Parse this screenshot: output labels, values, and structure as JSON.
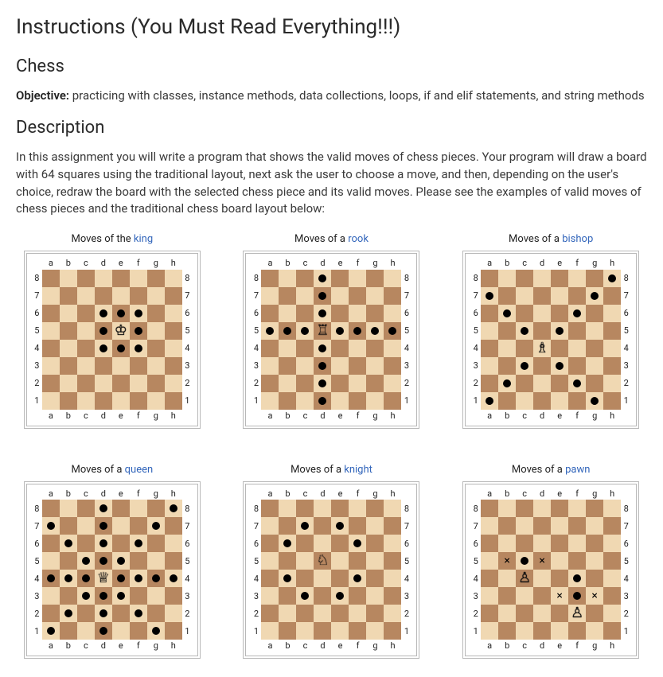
{
  "title": "Instructions (You Must Read Everything!!!)",
  "h_chess": "Chess",
  "objective_label": "Objective:",
  "objective_text": " practicing with classes, instance methods, data collections, loops, if and elif statements, and string methods",
  "h_description": "Description",
  "description_text": "In this assignment you will write a program that shows the valid moves of chess pieces. Your program will draw a board with 64 squares using the traditional layout, next ask the user to choose a move, and then, depending on the user's choice, redraw the board with the selected chess piece and its valid moves. Please see the examples of valid moves of chess pieces and the traditional chess board layout below:",
  "files": [
    "a",
    "b",
    "c",
    "d",
    "e",
    "f",
    "g",
    "h"
  ],
  "ranks": [
    "8",
    "7",
    "6",
    "5",
    "4",
    "3",
    "2",
    "1"
  ],
  "boards": [
    {
      "id": "king",
      "caption_prefix": "Moves of the ",
      "caption_link": "king",
      "piece_glyph": "♔",
      "piece_at": "e5",
      "dots": [
        "d6",
        "e6",
        "f6",
        "d5",
        "f5",
        "d4",
        "e4",
        "f4"
      ],
      "xmarks": []
    },
    {
      "id": "rook",
      "caption_prefix": "Moves of a ",
      "caption_link": "rook",
      "piece_glyph": "♖",
      "piece_at": "d5",
      "dots": [
        "d8",
        "d7",
        "d6",
        "a5",
        "b5",
        "c5",
        "e5",
        "f5",
        "g5",
        "h5",
        "d4",
        "d3",
        "d2",
        "d1"
      ],
      "xmarks": []
    },
    {
      "id": "bishop",
      "caption_prefix": "Moves of a ",
      "caption_link": "bishop",
      "piece_glyph": "♗",
      "piece_at": "d4",
      "dots": [
        "a7",
        "b6",
        "c5",
        "e3",
        "f2",
        "g1",
        "a1",
        "b2",
        "c3",
        "e5",
        "f6",
        "g7",
        "h8"
      ],
      "xmarks": []
    },
    {
      "id": "queen",
      "caption_prefix": "Moves of a ",
      "caption_link": "queen",
      "piece_glyph": "♕",
      "piece_at": "d4",
      "dots": [
        "d8",
        "h8",
        "a7",
        "d7",
        "g7",
        "b6",
        "d6",
        "f6",
        "c5",
        "d5",
        "e5",
        "a4",
        "b4",
        "c4",
        "e4",
        "f4",
        "g4",
        "h4",
        "c3",
        "d3",
        "e3",
        "b2",
        "d2",
        "f2",
        "a1",
        "d1",
        "g1"
      ],
      "xmarks": []
    },
    {
      "id": "knight",
      "caption_prefix": "Moves of a ",
      "caption_link": "knight",
      "piece_glyph": "♘",
      "piece_at": "d5",
      "dots": [
        "c7",
        "e7",
        "b6",
        "f6",
        "b4",
        "f4",
        "c3",
        "e3"
      ],
      "xmarks": []
    },
    {
      "id": "pawn",
      "caption_prefix": "Moves of a ",
      "caption_link": "pawn",
      "piece_glyph": "♙",
      "piece_at": "c4",
      "piece2_glyph": "♙",
      "piece2_at": "f2",
      "dots": [
        "c5",
        "f4",
        "f3"
      ],
      "xmarks": [
        "b5",
        "d5",
        "e3",
        "g3"
      ]
    }
  ]
}
